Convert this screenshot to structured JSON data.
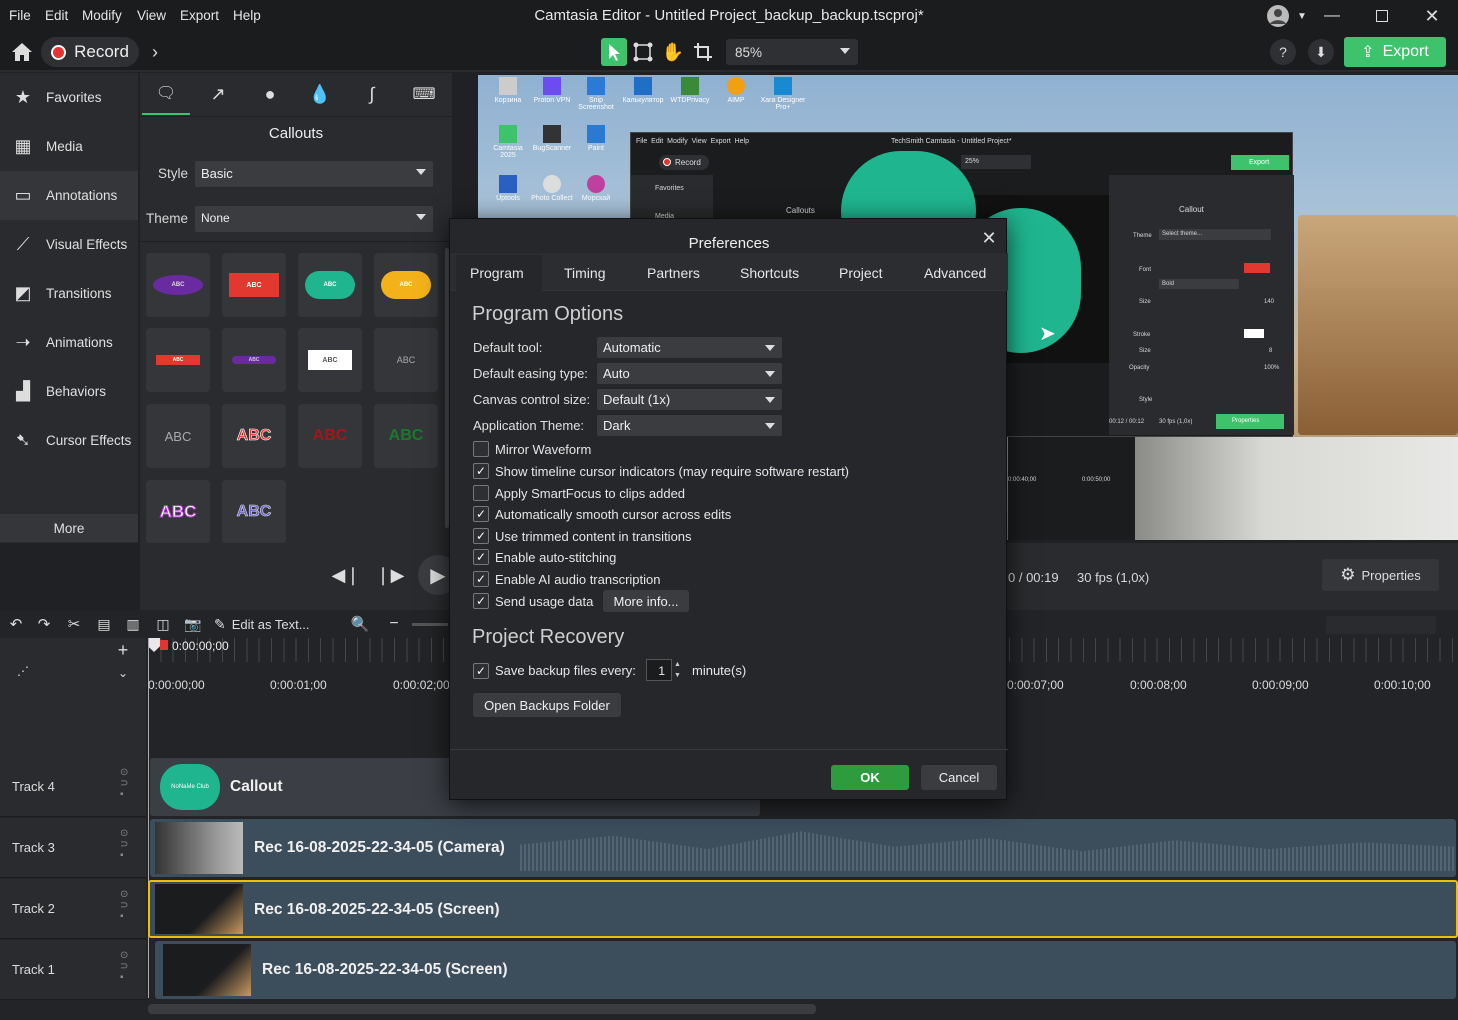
{
  "menu": [
    "File",
    "Edit",
    "Modify",
    "View",
    "Export",
    "Help"
  ],
  "window_title": "Camtasia Editor - Untitled Project_backup_backup.tscproj*",
  "toolbar": {
    "record_label": "Record",
    "zoom": "85%",
    "export_label": "Export"
  },
  "nav": {
    "items": [
      {
        "label": "Favorites",
        "icon": "star-icon"
      },
      {
        "label": "Media",
        "icon": "film-icon"
      },
      {
        "label": "Annotations",
        "icon": "annotation-icon"
      },
      {
        "label": "Visual Effects",
        "icon": "wand-icon"
      },
      {
        "label": "Transitions",
        "icon": "transition-icon"
      },
      {
        "label": "Animations",
        "icon": "arrow-icon"
      },
      {
        "label": "Behaviors",
        "icon": "behaviors-icon"
      },
      {
        "label": "Cursor Effects",
        "icon": "cursor-icon"
      }
    ],
    "more": "More"
  },
  "callouts": {
    "title": "Callouts",
    "style_label": "Style",
    "style_value": "Basic",
    "theme_label": "Theme",
    "theme_value": "None",
    "thumb_text": [
      "ABC",
      "ABC",
      "ABC",
      "ABC",
      "ABC",
      "ABC",
      "ABC",
      "ABC",
      "ABC",
      "ABC",
      "ABC",
      "ABC",
      "ABC",
      "ABC"
    ]
  },
  "playback": {
    "time": "0 / 00:19",
    "fps": "30 fps (1,0x)",
    "properties": "Properties"
  },
  "timeline": {
    "edit_as_text": "Edit as Text...",
    "playhead": "0:00:00;00",
    "ticks": [
      "0:00:00;00",
      "0:00:01;00",
      "0:00:02;00",
      "0:00:07;00",
      "0:00:08;00",
      "0:00:09;00",
      "0:00:10;00"
    ],
    "tracks": [
      {
        "name": "Track 4",
        "clip": "Callout",
        "thumb_text": "NoNaMe Club"
      },
      {
        "name": "Track 3",
        "clip": "Rec 16-08-2025-22-34-05 (Camera)"
      },
      {
        "name": "Track 2",
        "clip": "Rec 16-08-2025-22-34-05 (Screen)"
      },
      {
        "name": "Track 1",
        "clip": "Rec 16-08-2025-22-34-05 (Screen)"
      }
    ]
  },
  "dialog": {
    "title": "Preferences",
    "tabs": [
      "Program",
      "Timing",
      "Partners",
      "Shortcuts",
      "Project",
      "Advanced"
    ],
    "section1": "Program Options",
    "fields": [
      {
        "label": "Default tool:",
        "value": "Automatic"
      },
      {
        "label": "Default easing type:",
        "value": "Auto"
      },
      {
        "label": "Canvas control size:",
        "value": "Default (1x)"
      },
      {
        "label": "Application Theme:",
        "value": "Dark"
      }
    ],
    "checks": [
      {
        "label": "Mirror Waveform",
        "checked": false
      },
      {
        "label": "Show timeline cursor indicators (may require software restart)",
        "checked": true
      },
      {
        "label": "Apply SmartFocus to clips added",
        "checked": false
      },
      {
        "label": "Automatically smooth cursor across edits",
        "checked": true
      },
      {
        "label": "Use trimmed content in transitions",
        "checked": true
      },
      {
        "label": "Enable auto-stitching",
        "checked": true
      },
      {
        "label": "Enable AI audio transcription",
        "checked": true
      },
      {
        "label": "Send usage data",
        "checked": true
      }
    ],
    "more_info": "More info...",
    "section2": "Project Recovery",
    "backup_label": "Save backup files every:",
    "backup_value": "1",
    "backup_unit": "minute(s)",
    "open_backups": "Open Backups Folder",
    "ok": "OK",
    "cancel": "Cancel"
  },
  "inner_app": {
    "title": "TechSmith Camtasia - Untitled Project*",
    "record": "Record",
    "zoom": "25%",
    "export": "Export",
    "callout": "Callout",
    "callouts": "Callouts",
    "favorites": "Favorites",
    "media": "Media",
    "properties": "Properties",
    "time": "00:12 / 00:12",
    "fps": "30 fps (1,0x)",
    "tick1": "0:00:40;00",
    "tick2": "0:00:50;00",
    "labels": [
      "Theme",
      "Select theme...",
      "Font",
      "Bold",
      "Size",
      "140",
      "Stroke",
      "Size",
      "8",
      "Opacity",
      "100%",
      "Style"
    ]
  },
  "desktop_icons": [
    "Корзина",
    "Proton VPN",
    "Snip Screenshot",
    "Калькулятор",
    "WTDPrivacy",
    "AIMP",
    "Xara Designer Pro+",
    "Camtasia 2025",
    "BugScanner",
    "Paint",
    "Uptools",
    "Photo Collect",
    "Морскай"
  ],
  "colors": {
    "accent": "#3ec26b",
    "callout_teal": "#1fb58f",
    "ok": "#2e9b3e"
  }
}
